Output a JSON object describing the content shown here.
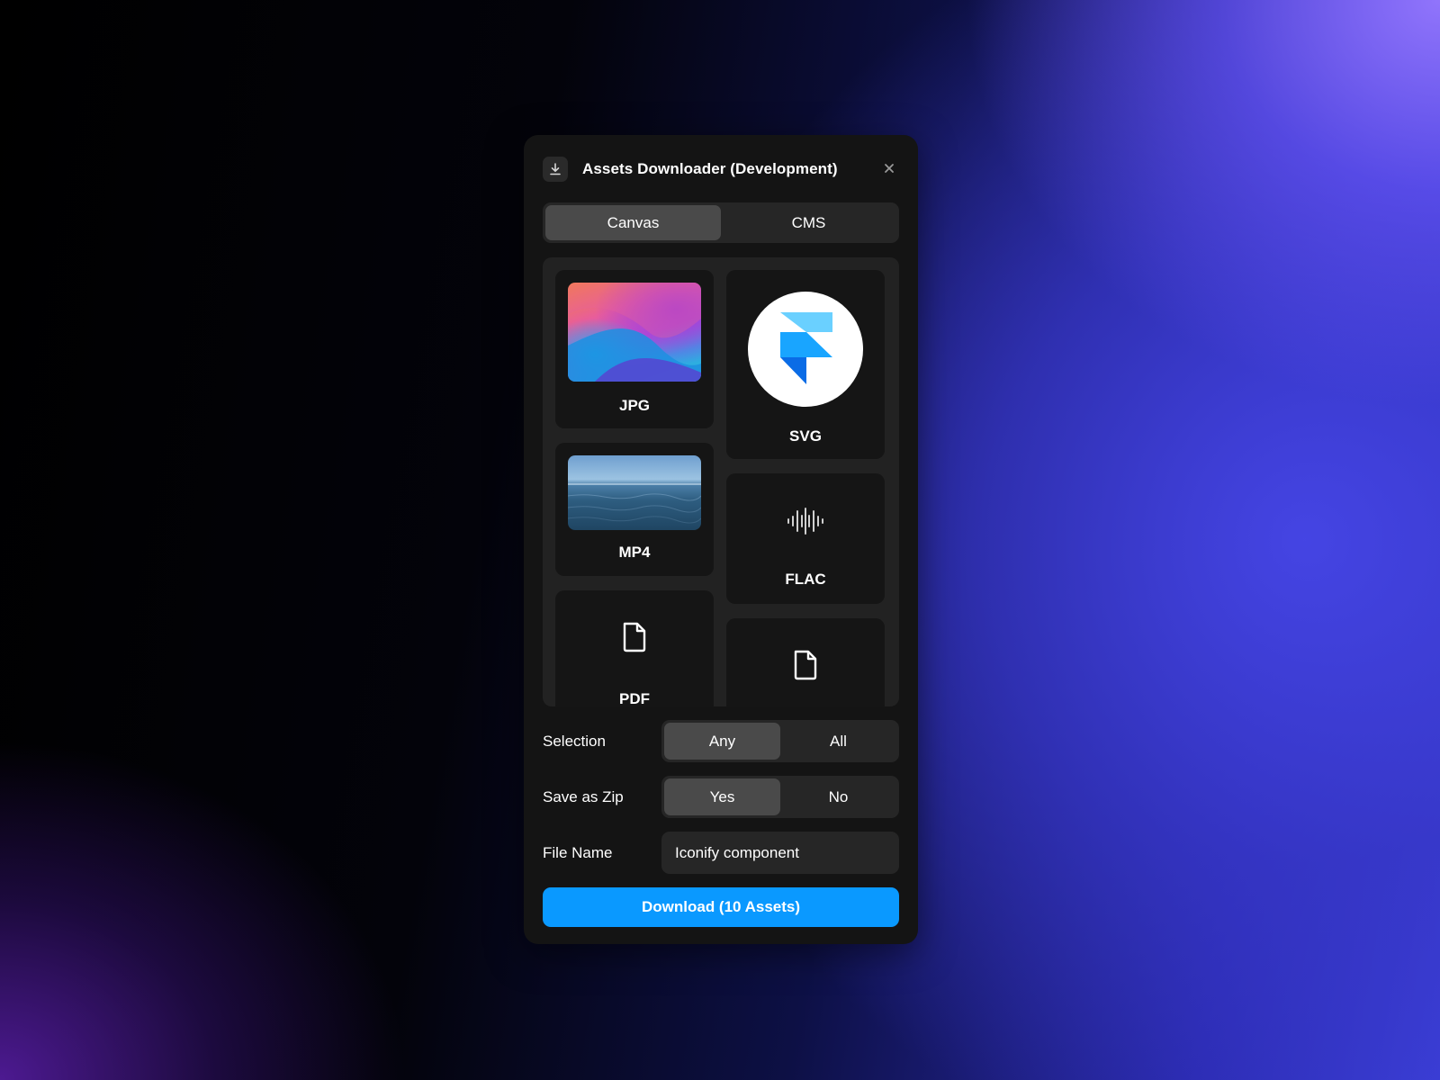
{
  "window": {
    "title": "Assets Downloader (Development)",
    "header_icon": "download-icon",
    "close_icon": "close-icon"
  },
  "tabs": [
    {
      "label": "Canvas",
      "active": true
    },
    {
      "label": "CMS",
      "active": false
    }
  ],
  "assets": {
    "left_column": [
      {
        "label": "JPG",
        "preview": "gradient-image"
      },
      {
        "label": "MP4",
        "preview": "ocean-video"
      },
      {
        "label": "PDF",
        "preview": "file-icon"
      }
    ],
    "right_column": [
      {
        "label": "SVG",
        "preview": "framer-logo"
      },
      {
        "label": "FLAC",
        "preview": "audio-waveform-icon"
      },
      {
        "label": "",
        "preview": "file-icon"
      }
    ]
  },
  "form": {
    "selection": {
      "label": "Selection",
      "options": [
        "Any",
        "All"
      ],
      "selected": "Any"
    },
    "save_as_zip": {
      "label": "Save as Zip",
      "options": [
        "Yes",
        "No"
      ],
      "selected": "Yes"
    },
    "file_name": {
      "label": "File Name",
      "value": "Iconify component"
    }
  },
  "download_button": {
    "label": "Download (10 Assets)"
  },
  "colors": {
    "panel": "#141414",
    "accent": "#0a99ff",
    "segment_bg": "#262626",
    "segment_active": "#4a4a4a"
  }
}
